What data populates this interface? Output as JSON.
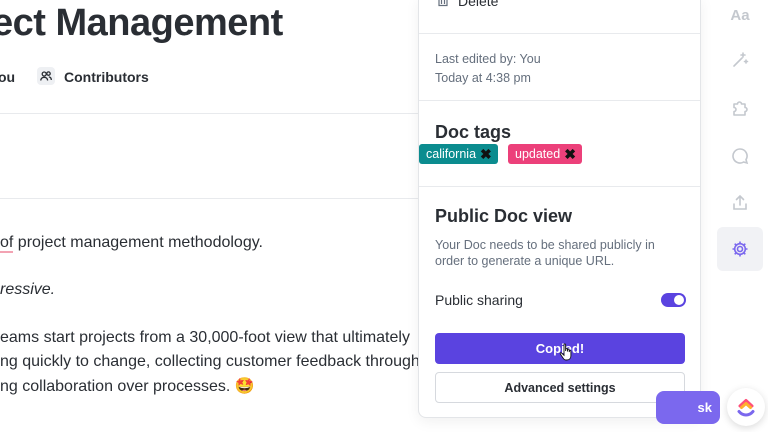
{
  "document": {
    "title": "ect Management",
    "meta": {
      "owner": "ou",
      "contributors_label": "Contributors"
    },
    "lines": {
      "line1_mark": "of",
      "line1_rest": " project management methodology.",
      "line2": "ressive.",
      "line3": "eams start projects from a 30,000-foot view that ultimately",
      "line4": "ng quickly to change, collecting customer feedback through",
      "line5": "ng collaboration over processes. 🤩"
    }
  },
  "panel": {
    "delete_label": "Delete",
    "last_edited_by": "Last edited by: You",
    "last_edited_time": "Today at 4:38 pm",
    "doc_tags_heading": "Doc tags",
    "tags": [
      {
        "label": "california",
        "color": "#0b8c8f"
      },
      {
        "label": "updated",
        "color": "#ec407a"
      }
    ],
    "public_heading": "Public Doc view",
    "public_description": "Your Doc needs to be shared publicly in order to generate a unique URL.",
    "public_sharing_label": "Public sharing",
    "public_sharing_on": true,
    "copied_button": "Copied!",
    "advanced_button": "Advanced settings"
  },
  "rail": {
    "font_label": "Aa",
    "icons": [
      "font-icon",
      "sparkle-icon",
      "puzzle-icon",
      "chat-icon",
      "share-icon",
      "gear-icon"
    ]
  },
  "floating": {
    "task_label": "sk"
  },
  "colors": {
    "accent": "#5a43e0",
    "accent_light": "#7b68ee",
    "text": "#2a2e34",
    "muted": "#656f7d"
  }
}
